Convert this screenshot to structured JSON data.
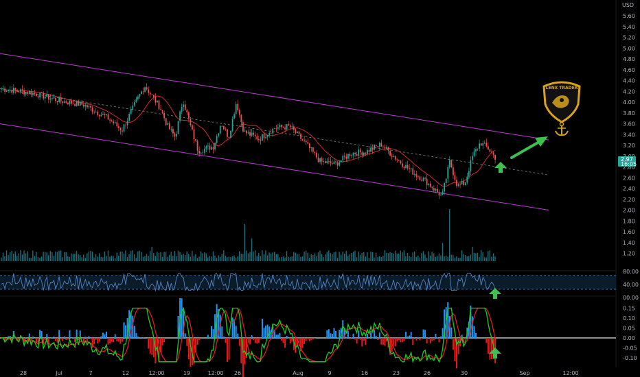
{
  "currency_label": "USD",
  "last_price": {
    "value": "2.97",
    "countdown": "16:05"
  },
  "colors": {
    "background": "#000000",
    "candle_up": "#26a69a",
    "candle_down": "#ef5350",
    "channel": "#c03ad8",
    "ma": "#d12a2a",
    "volume": "#1e6e7c",
    "rsi": "#5b8fd6",
    "macd_fast": "#1fcc1f",
    "macd_slow": "#e0201c",
    "hist_pos": "#2196f3",
    "hist_neg": "#e81b1b",
    "arrow": "#3fbf4f",
    "logo_gold": "#d9a419",
    "last_price_bg": "#26a69a"
  },
  "logo": {
    "text": "LENX TRADER"
  },
  "icons": [
    "arrow-up-icon",
    "arrow-up-right-icon",
    "anchor-icon",
    "shield-logo-icon"
  ],
  "chart_data": {
    "type": "candlestick",
    "price_axis": {
      "ticks": [
        "5.60",
        "5.40",
        "5.20",
        "5.00",
        "4.80",
        "4.60",
        "4.40",
        "4.20",
        "4.00",
        "3.80",
        "3.60",
        "3.40",
        "3.20",
        "3.00",
        "2.80",
        "2.60",
        "2.40",
        "2.20",
        "2.00",
        "1.80",
        "1.60",
        "1.40",
        "1.20"
      ]
    },
    "rsi_axis": {
      "ticks": [
        "80.00",
        "40.00",
        "00.00"
      ],
      "bands": [
        70,
        30
      ]
    },
    "macd_axis": {
      "ticks": [
        "0.15",
        "0.10",
        "0.05",
        "0.00",
        "-0.05",
        "-0.10"
      ]
    },
    "x_axis": {
      "ticks": [
        "28",
        "Jul",
        "7",
        "12",
        "12:00",
        "19",
        "12:00",
        "26",
        "Aug",
        "9",
        "16",
        "23",
        "26",
        "30",
        "Sep",
        "12:00"
      ]
    },
    "price_path": [
      [
        "Jun 24",
        4.25
      ],
      [
        "Jun 28",
        4.18
      ],
      [
        "Jul 2",
        4.02
      ],
      [
        "Jul 5",
        3.95
      ],
      [
        "Jul 8",
        3.72
      ],
      [
        "Jul 10",
        3.48
      ],
      [
        "Jul 12",
        4.05
      ],
      [
        "Jul 13",
        4.3
      ],
      [
        "Jul 15",
        3.9
      ],
      [
        "Jul 16",
        3.55
      ],
      [
        "Jul 17",
        3.35
      ],
      [
        "Jul 18",
        4.05
      ],
      [
        "Jul 19",
        3.55
      ],
      [
        "Jul 20",
        3.1
      ],
      [
        "Jul 22",
        3.18
      ],
      [
        "Jul 23",
        3.62
      ],
      [
        "Jul 24",
        3.35
      ],
      [
        "Jul 25",
        4.0
      ],
      [
        "Jul 26",
        3.45
      ],
      [
        "Jul 28",
        3.32
      ],
      [
        "Jul 30",
        3.52
      ],
      [
        "Aug 1",
        3.55
      ],
      [
        "Aug 3",
        3.25
      ],
      [
        "Aug 5",
        2.9
      ],
      [
        "Aug 7",
        2.85
      ],
      [
        "Aug 9",
        3.05
      ],
      [
        "Aug 11",
        3.08
      ],
      [
        "Aug 13",
        3.22
      ],
      [
        "Aug 15",
        2.95
      ],
      [
        "Aug 17",
        2.72
      ],
      [
        "Aug 19",
        2.52
      ],
      [
        "Aug 21",
        2.25
      ],
      [
        "Aug 22",
        2.9
      ],
      [
        "Aug 23",
        2.45
      ],
      [
        "Aug 24",
        2.5
      ],
      [
        "Aug 25",
        3.0
      ],
      [
        "Aug 26",
        3.25
      ],
      [
        "Aug 27",
        3.15
      ],
      [
        "Aug 28",
        2.97
      ]
    ],
    "channel_upper": [
      [
        "Jun 24",
        4.9
      ],
      [
        "Sep 4",
        3.3
      ]
    ],
    "channel_lower": [
      [
        "Jun 24",
        3.6
      ],
      [
        "Sep 4",
        2.0
      ]
    ],
    "channel_mid": [
      [
        "Jun 24",
        4.25
      ],
      [
        "Sep 4",
        2.65
      ]
    ],
    "volume_spikes": [
      [
        "Jul 18",
        1.0
      ],
      [
        "Jul 26",
        0.57
      ],
      [
        "Jul 27",
        0.35
      ],
      [
        "Aug 22",
        0.8
      ],
      [
        "Jul 14",
        0.22
      ],
      [
        "Aug 21",
        0.28
      ],
      [
        "Aug 25",
        0.22
      ],
      [
        "Aug 26",
        0.17
      ]
    ],
    "rsi_range": [
      30,
      70
    ],
    "macd_range": [
      -0.13,
      0.16
    ]
  }
}
